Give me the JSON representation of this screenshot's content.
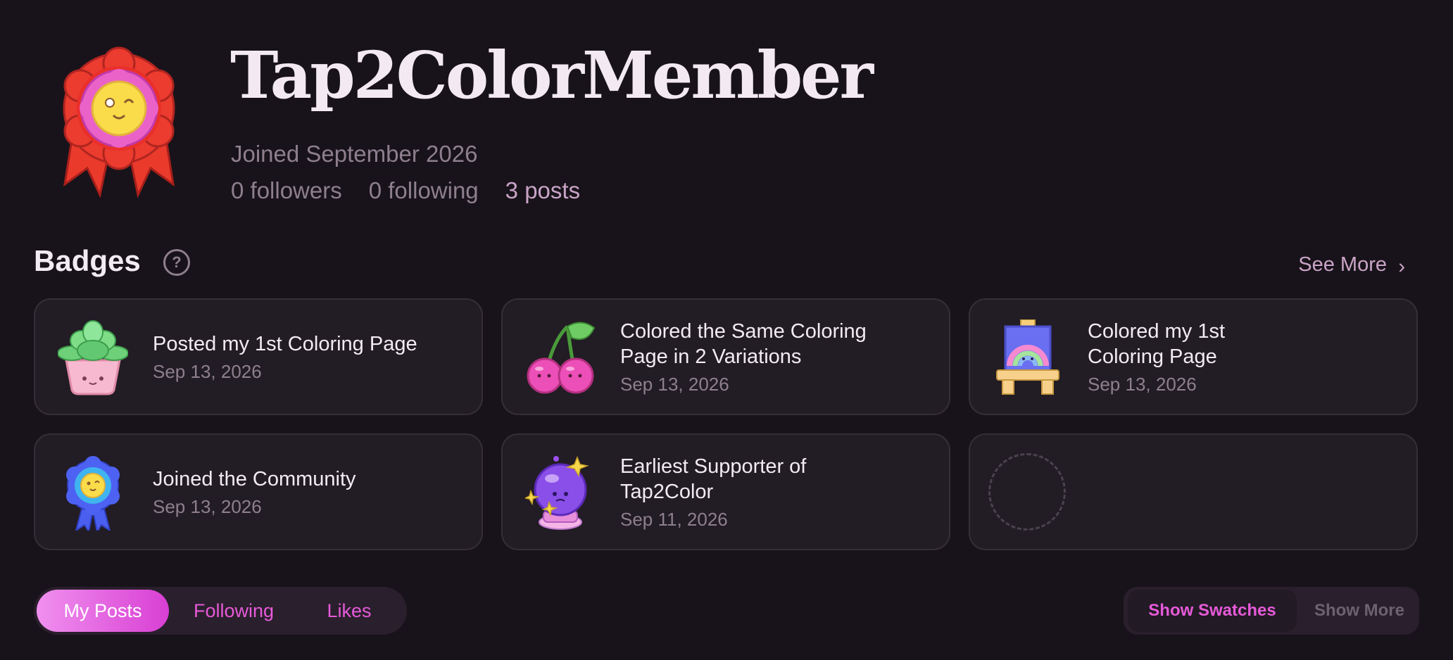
{
  "profile": {
    "username": "Tap2ColorMember",
    "joined": "Joined September 2026",
    "followers": "0 followers",
    "following": "0 following",
    "posts": "3 posts",
    "avatar_icon": "rosette-award-icon"
  },
  "badges": {
    "title": "Badges",
    "help_icon": "?",
    "see_more": "See More",
    "see_more_chevron": "›",
    "items": [
      {
        "name": "Posted my 1st Coloring Page",
        "date": "Sep 13, 2026",
        "icon": "succulent-plant-icon"
      },
      {
        "name": "Colored the Same Coloring Page in 2 Variations",
        "date": "Sep 13, 2026",
        "icon": "cherries-icon"
      },
      {
        "name": "Colored my 1st Coloring Page",
        "date": "Sep 13, 2026",
        "icon": "rainbow-easel-icon"
      },
      {
        "name": "Joined the Community",
        "date": "Sep 13, 2026",
        "icon": "blue-ribbon-icon"
      },
      {
        "name": "Earliest Supporter of Tap2Color",
        "date": "Sep 11, 2026",
        "icon": "crystal-ball-icon"
      }
    ],
    "empty_slot_icon": "empty-badge-slot-icon"
  },
  "tabs": [
    {
      "label": "My Posts",
      "active": true
    },
    {
      "label": "Following",
      "active": false
    },
    {
      "label": "Likes",
      "active": false
    }
  ],
  "view_toggles": {
    "show_swatches": "Show Swatches",
    "show_more": "Show More"
  },
  "colors": {
    "background": "#18131a",
    "card": "#221c24",
    "accent": "#e65ad9",
    "muted_text": "#8e7f8e"
  }
}
